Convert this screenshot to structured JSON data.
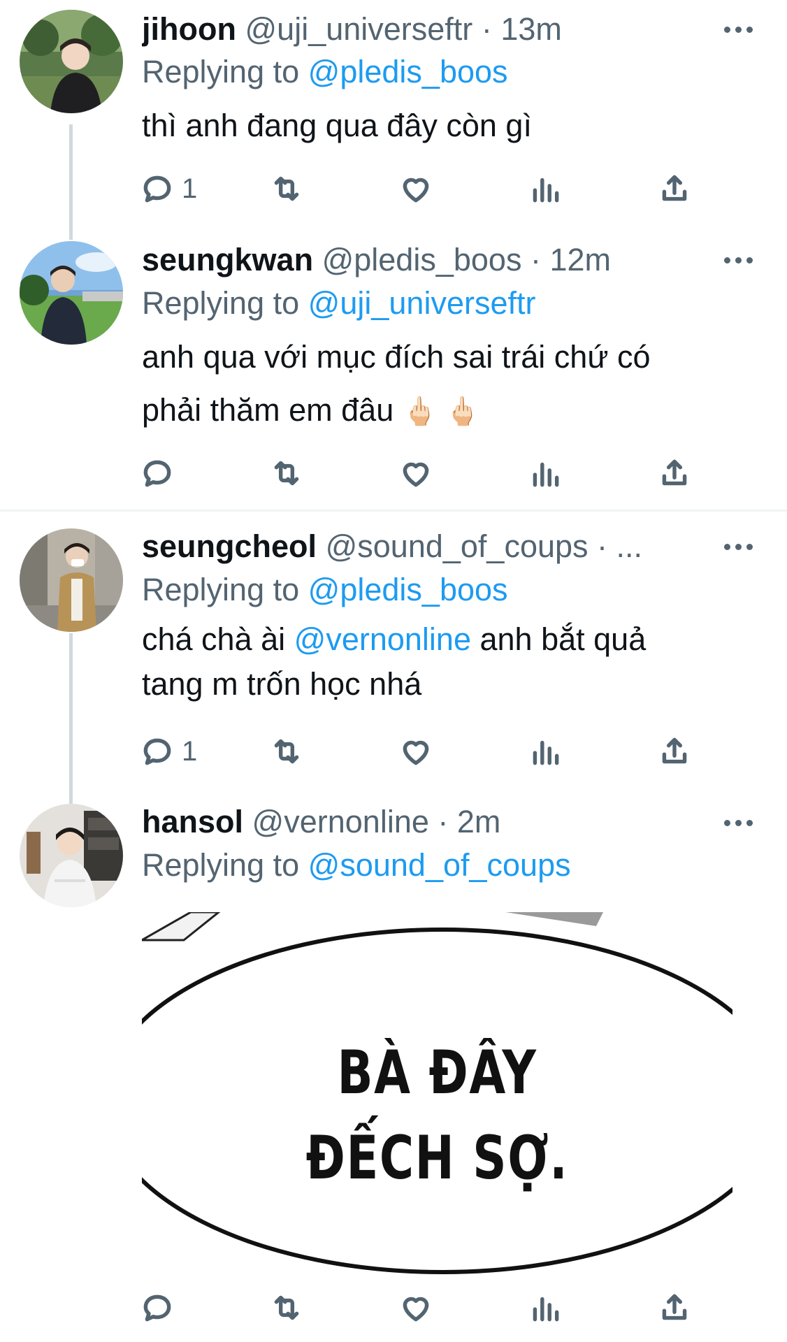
{
  "tweets": [
    {
      "name": "jihoon",
      "handle": "@uji_universeftr",
      "dot": "·",
      "time": "13m",
      "replying_prefix": "Replying to",
      "replying_to": "@pledis_boos",
      "text": "thì anh đang qua đây còn gì",
      "reply_count": "1"
    },
    {
      "name": "seungkwan",
      "handle": "@pledis_boos",
      "dot": "·",
      "time": "12m",
      "replying_prefix": "Replying to",
      "replying_to": "@uji_universeftr",
      "text_line1": "anh qua với mục đích sai trái chứ có",
      "text_line2": "phải thăm em đâu",
      "emoji": "🖕🏻 🖕🏻",
      "reply_count": ""
    },
    {
      "name": "seungcheol",
      "handle": "@sound_of_coups",
      "dot": "· ...",
      "time": "",
      "replying_prefix": "Replying to",
      "replying_to": "@pledis_boos",
      "text_pre": "chá chà ài",
      "text_mention": "@vernonline",
      "text_post": "anh bắt quả",
      "text_line2": "tang m trốn học nhá",
      "reply_count": "1"
    },
    {
      "name": "hansol",
      "handle": "@vernonline",
      "dot": "·",
      "time": "2m",
      "replying_prefix": "Replying to",
      "replying_to": "@sound_of_coups",
      "media_line1": "BÀ ĐÂY",
      "media_line2": "ĐẾCH SỢ.",
      "reply_count": ""
    }
  ],
  "icons": {
    "reply": "reply-icon",
    "retweet": "retweet-icon",
    "like": "like-icon",
    "views": "views-icon",
    "share": "share-icon",
    "more": "more-icon"
  },
  "colors": {
    "link": "#1d9bf0",
    "secondary": "#536471",
    "thread_line": "#cfd9de"
  }
}
